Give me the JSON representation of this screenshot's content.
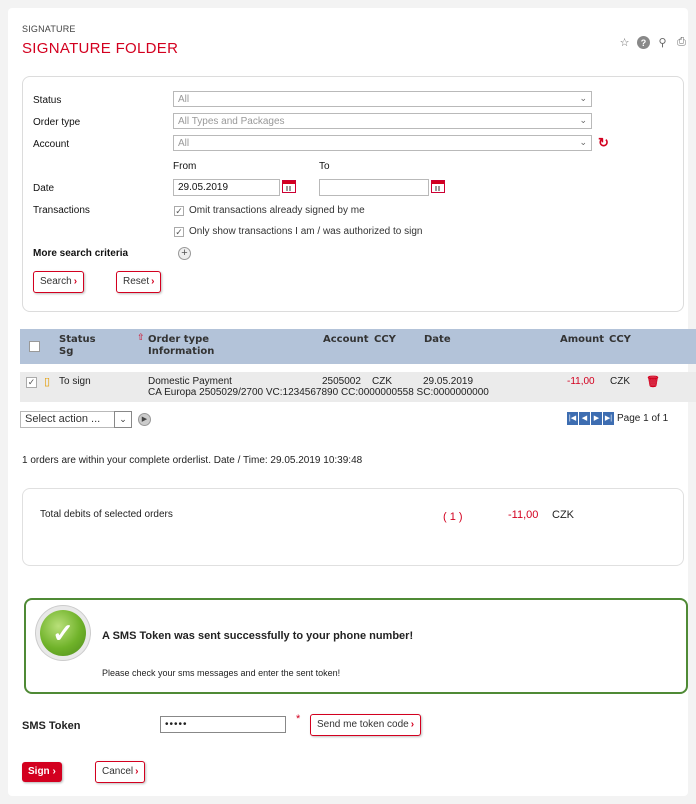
{
  "header": {
    "breadcrumb": "SIGNATURE",
    "title": "SIGNATURE FOLDER"
  },
  "top_icons": [
    "star-icon",
    "help-icon",
    "pin-icon",
    "print-icon"
  ],
  "search": {
    "status_label": "Status",
    "status_value": "All",
    "order_type_label": "Order type",
    "order_type_value": "All Types and Packages",
    "account_label": "Account",
    "account_value": "All",
    "from_label": "From",
    "to_label": "To",
    "date_label": "Date",
    "date_from": "29.05.2019",
    "date_to": "",
    "transactions_label": "Transactions",
    "omit_signed": "Omit transactions already signed by me",
    "only_authorized": "Only show transactions I am / was authorized to sign",
    "more_criteria": "More search criteria",
    "search_button": "Search",
    "reset_button": "Reset"
  },
  "table": {
    "headers": {
      "status": "Status",
      "status_sub": "Sg",
      "order_type": "Order type",
      "information": "Information",
      "account": "Account",
      "ccy": "CCY",
      "date": "Date",
      "amount": "Amount",
      "ccy2": "CCY"
    },
    "rows": [
      {
        "status": "To sign",
        "order_type": "Domestic Payment",
        "account": "2505002",
        "ccy": "CZK",
        "date": "29.05.2019",
        "amount": "-11,00",
        "amount_ccy": "CZK",
        "information": "CA Europa 2505029/2700 VC:1234567890 CC:0000000558 SC:0000000000"
      }
    ]
  },
  "action_select": "Select action ...",
  "pager_text": "Page 1 of 1",
  "order_summary": "1 orders are within your complete orderlist. Date / Time: 29.05.2019 10:39:48",
  "totals": {
    "label": "Total debits of selected orders",
    "count": "( 1 )",
    "amount": "-11,00",
    "ccy": "CZK"
  },
  "message": {
    "title": "A SMS Token was sent successfully to your phone number!",
    "body": "Please check your sms messages and enter the sent token!"
  },
  "sms": {
    "label": "SMS Token",
    "value": "•••••",
    "required_mark": "*",
    "send_button": "Send me token code"
  },
  "actions": {
    "sign": "Sign",
    "cancel": "Cancel"
  },
  "colors": {
    "brand_red": "#d3001f",
    "header_blue": "#b3c3d9",
    "success_green": "#4f8a35"
  }
}
